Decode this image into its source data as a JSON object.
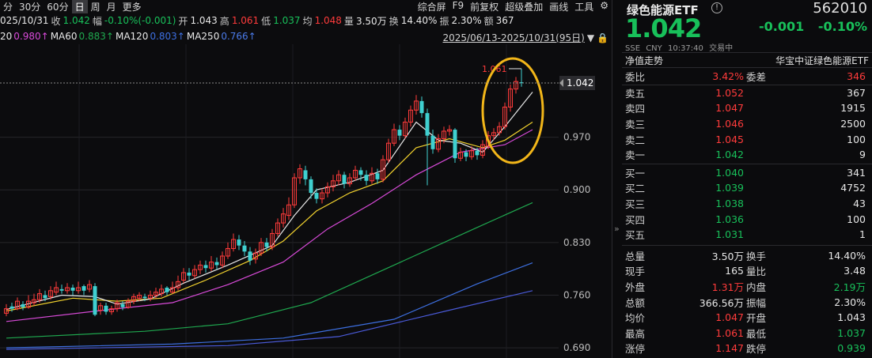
{
  "toolbar": {
    "left": [
      {
        "label": "分",
        "active": false
      },
      {
        "label": "30分",
        "active": false
      },
      {
        "label": "60分",
        "active": false
      },
      {
        "label": "日",
        "active": true
      },
      {
        "label": "周",
        "active": false
      },
      {
        "label": "月",
        "active": false
      },
      {
        "label": "更多",
        "active": false
      }
    ],
    "right": [
      "综合屏",
      "F9",
      "前复权",
      "超级叠加",
      "画线",
      "工具"
    ],
    "settings_icon": "gear-icon"
  },
  "quote": {
    "date": "025/10/31",
    "close_label": "收",
    "close": "1.042",
    "change_label": "幅",
    "change": "-0.10%(-0.001)",
    "open_label": "开",
    "open": "1.043",
    "high_label": "高",
    "high": "1.061",
    "low_label": "低",
    "low": "1.037",
    "avg_label": "均",
    "avg": "1.048",
    "volume_label": "量",
    "volume": "3.50万",
    "turnover_label": "换",
    "turnover": "14.40%",
    "amplitude_label": "振",
    "amplitude": "2.30%",
    "amount_label": "额",
    "amount": "367"
  },
  "ma": {
    "ma20_label": "20",
    "ma20": "0.980↑",
    "ma60_label": "MA60",
    "ma60": "0.883↑",
    "ma120_label": "MA120",
    "ma120": "0.803↑",
    "ma250_label": "MA250",
    "ma250": "0.766↑",
    "range": "2025/06/13-2025/10/31(95日)"
  },
  "colors": {
    "up": "#ff3b3b",
    "down": "#18c05a",
    "down_candle": "#3fd0d0",
    "ma5": "#e8e8e8",
    "ma10": "#f2d22e",
    "ma20": "#d84ad8",
    "ma60": "#1fa84f",
    "ma120": "#3d6fe0",
    "ma250": "#4a5ad8",
    "highlight": "#f2b619",
    "price_tag_bg": "#2b2b2f"
  },
  "chart_data": {
    "type": "candlestick",
    "y_ticks": [
      "0.970",
      "0.900",
      "0.830",
      "0.760",
      "0.690"
    ],
    "ylim": [
      0.6765,
      1.0935
    ],
    "current_price_label": "1.042",
    "high_marker": "1.061",
    "candles": [
      [
        0.736,
        0.742,
        0.748,
        0.732
      ],
      [
        0.745,
        0.742,
        0.75,
        0.738
      ],
      [
        0.742,
        0.752,
        0.757,
        0.74
      ],
      [
        0.748,
        0.744,
        0.752,
        0.74
      ],
      [
        0.744,
        0.752,
        0.76,
        0.742
      ],
      [
        0.75,
        0.754,
        0.762,
        0.746
      ],
      [
        0.754,
        0.762,
        0.768,
        0.75
      ],
      [
        0.76,
        0.756,
        0.766,
        0.752
      ],
      [
        0.758,
        0.766,
        0.772,
        0.754
      ],
      [
        0.764,
        0.77,
        0.778,
        0.76
      ],
      [
        0.768,
        0.766,
        0.774,
        0.762
      ],
      [
        0.766,
        0.77,
        0.776,
        0.762
      ],
      [
        0.77,
        0.766,
        0.774,
        0.76
      ],
      [
        0.766,
        0.77,
        0.778,
        0.762
      ],
      [
        0.772,
        0.766,
        0.774,
        0.76
      ],
      [
        0.768,
        0.774,
        0.78,
        0.764
      ],
      [
        0.772,
        0.734,
        0.776,
        0.732
      ],
      [
        0.74,
        0.746,
        0.75,
        0.734
      ],
      [
        0.746,
        0.738,
        0.75,
        0.734
      ],
      [
        0.738,
        0.742,
        0.746,
        0.734
      ],
      [
        0.742,
        0.75,
        0.754,
        0.738
      ],
      [
        0.748,
        0.744,
        0.752,
        0.74
      ],
      [
        0.744,
        0.752,
        0.756,
        0.742
      ],
      [
        0.752,
        0.758,
        0.762,
        0.748
      ],
      [
        0.756,
        0.76,
        0.764,
        0.752
      ],
      [
        0.758,
        0.756,
        0.762,
        0.752
      ],
      [
        0.756,
        0.76,
        0.766,
        0.752
      ],
      [
        0.76,
        0.764,
        0.77,
        0.756
      ],
      [
        0.762,
        0.768,
        0.774,
        0.758
      ],
      [
        0.77,
        0.764,
        0.772,
        0.76
      ],
      [
        0.764,
        0.77,
        0.778,
        0.762
      ],
      [
        0.77,
        0.778,
        0.786,
        0.766
      ],
      [
        0.78,
        0.79,
        0.796,
        0.776
      ],
      [
        0.79,
        0.786,
        0.796,
        0.78
      ],
      [
        0.786,
        0.794,
        0.8,
        0.782
      ],
      [
        0.794,
        0.8,
        0.806,
        0.788
      ],
      [
        0.8,
        0.796,
        0.806,
        0.79
      ],
      [
        0.796,
        0.804,
        0.812,
        0.792
      ],
      [
        0.804,
        0.8,
        0.81,
        0.794
      ],
      [
        0.8,
        0.812,
        0.818,
        0.796
      ],
      [
        0.812,
        0.822,
        0.83,
        0.808
      ],
      [
        0.822,
        0.834,
        0.842,
        0.818
      ],
      [
        0.834,
        0.826,
        0.84,
        0.82
      ],
      [
        0.826,
        0.818,
        0.832,
        0.812
      ],
      [
        0.818,
        0.806,
        0.824,
        0.8
      ],
      [
        0.808,
        0.816,
        0.822,
        0.802
      ],
      [
        0.816,
        0.83,
        0.836,
        0.812
      ],
      [
        0.83,
        0.824,
        0.836,
        0.818
      ],
      [
        0.824,
        0.842,
        0.848,
        0.82
      ],
      [
        0.842,
        0.856,
        0.862,
        0.838
      ],
      [
        0.856,
        0.868,
        0.876,
        0.85
      ],
      [
        0.866,
        0.88,
        0.89,
        0.86
      ],
      [
        0.88,
        0.916,
        0.922,
        0.876
      ],
      [
        0.916,
        0.928,
        0.934,
        0.908
      ],
      [
        0.926,
        0.914,
        0.932,
        0.906
      ],
      [
        0.914,
        0.896,
        0.918,
        0.888
      ],
      [
        0.896,
        0.888,
        0.902,
        0.882
      ],
      [
        0.888,
        0.896,
        0.902,
        0.882
      ],
      [
        0.896,
        0.904,
        0.91,
        0.89
      ],
      [
        0.904,
        0.912,
        0.92,
        0.898
      ],
      [
        0.912,
        0.92,
        0.926,
        0.906
      ],
      [
        0.92,
        0.908,
        0.924,
        0.902
      ],
      [
        0.908,
        0.916,
        0.922,
        0.904
      ],
      [
        0.916,
        0.926,
        0.932,
        0.912
      ],
      [
        0.926,
        0.92,
        0.93,
        0.912
      ],
      [
        0.92,
        0.912,
        0.926,
        0.906
      ],
      [
        0.912,
        0.922,
        0.93,
        0.908
      ],
      [
        0.922,
        0.914,
        0.928,
        0.908
      ],
      [
        0.914,
        0.94,
        0.946,
        0.91
      ],
      [
        0.94,
        0.962,
        0.968,
        0.936
      ],
      [
        0.962,
        0.98,
        0.988,
        0.958
      ],
      [
        0.98,
        0.972,
        0.986,
        0.966
      ],
      [
        0.972,
        0.99,
        0.996,
        0.968
      ],
      [
        0.99,
        1.006,
        1.012,
        0.984
      ],
      [
        1.006,
        1.018,
        1.026,
        1.0
      ],
      [
        1.018,
        1.002,
        1.024,
        0.996
      ],
      [
        1.002,
        0.972,
        1.008,
        0.906
      ],
      [
        0.972,
        0.954,
        0.98,
        0.948
      ],
      [
        0.954,
        0.968,
        0.974,
        0.95
      ],
      [
        0.968,
        0.978,
        0.984,
        0.962
      ],
      [
        0.978,
        0.98,
        0.986,
        0.972
      ],
      [
        0.98,
        0.942,
        0.982,
        0.936
      ],
      [
        0.942,
        0.95,
        0.956,
        0.938
      ],
      [
        0.95,
        0.944,
        0.954,
        0.938
      ],
      [
        0.944,
        0.952,
        0.958,
        0.94
      ],
      [
        0.952,
        0.946,
        0.956,
        0.94
      ],
      [
        0.946,
        0.96,
        0.966,
        0.942
      ],
      [
        0.958,
        0.972,
        0.978,
        0.954
      ],
      [
        0.972,
        0.976,
        0.982,
        0.966
      ],
      [
        0.976,
        0.984,
        0.99,
        0.972
      ],
      [
        0.984,
        1.01,
        1.016,
        0.98
      ],
      [
        1.01,
        1.034,
        1.04,
        1.004
      ],
      [
        1.034,
        1.044,
        1.05,
        1.028
      ],
      [
        1.043,
        1.042,
        1.061,
        1.037
      ]
    ],
    "ma_lines": {
      "ma5": [
        [
          0,
          0.741
        ],
        [
          10,
          0.76
        ],
        [
          16,
          0.758
        ],
        [
          20,
          0.748
        ],
        [
          26,
          0.755
        ],
        [
          32,
          0.776
        ],
        [
          40,
          0.8
        ],
        [
          48,
          0.826
        ],
        [
          52,
          0.866
        ],
        [
          56,
          0.9
        ],
        [
          62,
          0.91
        ],
        [
          68,
          0.926
        ],
        [
          74,
          0.99
        ],
        [
          78,
          0.966
        ],
        [
          82,
          0.962
        ],
        [
          86,
          0.95
        ],
        [
          90,
          0.984
        ],
        [
          95,
          1.03
        ]
      ],
      "ma10": [
        [
          0,
          0.739
        ],
        [
          12,
          0.756
        ],
        [
          20,
          0.752
        ],
        [
          28,
          0.756
        ],
        [
          36,
          0.78
        ],
        [
          44,
          0.806
        ],
        [
          50,
          0.832
        ],
        [
          56,
          0.872
        ],
        [
          62,
          0.896
        ],
        [
          68,
          0.912
        ],
        [
          74,
          0.956
        ],
        [
          80,
          0.968
        ],
        [
          86,
          0.956
        ],
        [
          90,
          0.966
        ],
        [
          95,
          0.99
        ]
      ],
      "ma20": [
        [
          0,
          0.725
        ],
        [
          20,
          0.742
        ],
        [
          30,
          0.75
        ],
        [
          40,
          0.774
        ],
        [
          50,
          0.804
        ],
        [
          58,
          0.848
        ],
        [
          66,
          0.882
        ],
        [
          74,
          0.92
        ],
        [
          82,
          0.95
        ],
        [
          90,
          0.96
        ],
        [
          95,
          0.98
        ]
      ],
      "ma60": [
        [
          0,
          0.703
        ],
        [
          25,
          0.712
        ],
        [
          40,
          0.722
        ],
        [
          55,
          0.75
        ],
        [
          70,
          0.8
        ],
        [
          85,
          0.85
        ],
        [
          95,
          0.883
        ]
      ],
      "ma120": [
        [
          0,
          0.69
        ],
        [
          30,
          0.695
        ],
        [
          50,
          0.703
        ],
        [
          70,
          0.728
        ],
        [
          85,
          0.775
        ],
        [
          95,
          0.803
        ]
      ],
      "ma250": [
        [
          0,
          0.688
        ],
        [
          40,
          0.693
        ],
        [
          60,
          0.705
        ],
        [
          80,
          0.74
        ],
        [
          95,
          0.766
        ]
      ]
    }
  },
  "panel": {
    "name": "绿色能源ETF",
    "code": "562010",
    "price": "1.042",
    "change": "-0.001",
    "change_pct": "-0.10%",
    "exchange": "SSE",
    "currency": "CNY",
    "time": "10:37:40",
    "status": "交易中",
    "tab_left": "净值走势",
    "tab_right": "华宝中证绿色能源ETF",
    "weibi_label": "委比",
    "weibi": "3.42%",
    "weicha_label": "委差",
    "weicha": "346",
    "asks": [
      {
        "label": "卖五",
        "price": "1.052",
        "vol": "367",
        "color": "#ff3b3b"
      },
      {
        "label": "卖四",
        "price": "1.047",
        "vol": "1915",
        "color": "#ff3b3b"
      },
      {
        "label": "卖三",
        "price": "1.046",
        "vol": "2500",
        "color": "#ff3b3b"
      },
      {
        "label": "卖二",
        "price": "1.045",
        "vol": "100",
        "color": "#ff3b3b"
      },
      {
        "label": "卖一",
        "price": "1.042",
        "vol": "9",
        "color": "#18c05a"
      }
    ],
    "bids": [
      {
        "label": "买一",
        "price": "1.040",
        "vol": "341",
        "color": "#18c05a"
      },
      {
        "label": "买二",
        "price": "1.039",
        "vol": "4752",
        "color": "#18c05a"
      },
      {
        "label": "买三",
        "price": "1.038",
        "vol": "43",
        "color": "#18c05a"
      },
      {
        "label": "买四",
        "price": "1.036",
        "vol": "100",
        "color": "#18c05a"
      },
      {
        "label": "买五",
        "price": "1.031",
        "vol": "1",
        "color": "#18c05a"
      }
    ],
    "stats": [
      {
        "l1": "总量",
        "v1": "3.50万",
        "c1": "#e6e6e6",
        "l2": "换手",
        "v2": "14.40%",
        "c2": "#e6e6e6"
      },
      {
        "l1": "现手",
        "v1": "165",
        "c1": "#e6e6e6",
        "l2": "量比",
        "v2": "3.48",
        "c2": "#e6e6e6"
      },
      {
        "l1": "外盘",
        "v1": "1.31万",
        "c1": "#ff3b3b",
        "l2": "内盘",
        "v2": "2.19万",
        "c2": "#18c05a"
      },
      {
        "l1": "总额",
        "v1": "366.56万",
        "c1": "#e6e6e6",
        "l2": "振幅",
        "v2": "2.30%",
        "c2": "#e6e6e6"
      },
      {
        "l1": "均价",
        "v1": "1.047",
        "c1": "#ff3b3b",
        "l2": "开盘",
        "v2": "1.043",
        "c2": "#e6e6e6"
      },
      {
        "l1": "最高",
        "v1": "1.061",
        "c1": "#ff3b3b",
        "l2": "最低",
        "v2": "1.037",
        "c2": "#18c05a"
      },
      {
        "l1": "涨停",
        "v1": "1.147",
        "c1": "#ff3b3b",
        "l2": "跌停",
        "v2": "0.939",
        "c2": "#18c05a"
      }
    ]
  }
}
